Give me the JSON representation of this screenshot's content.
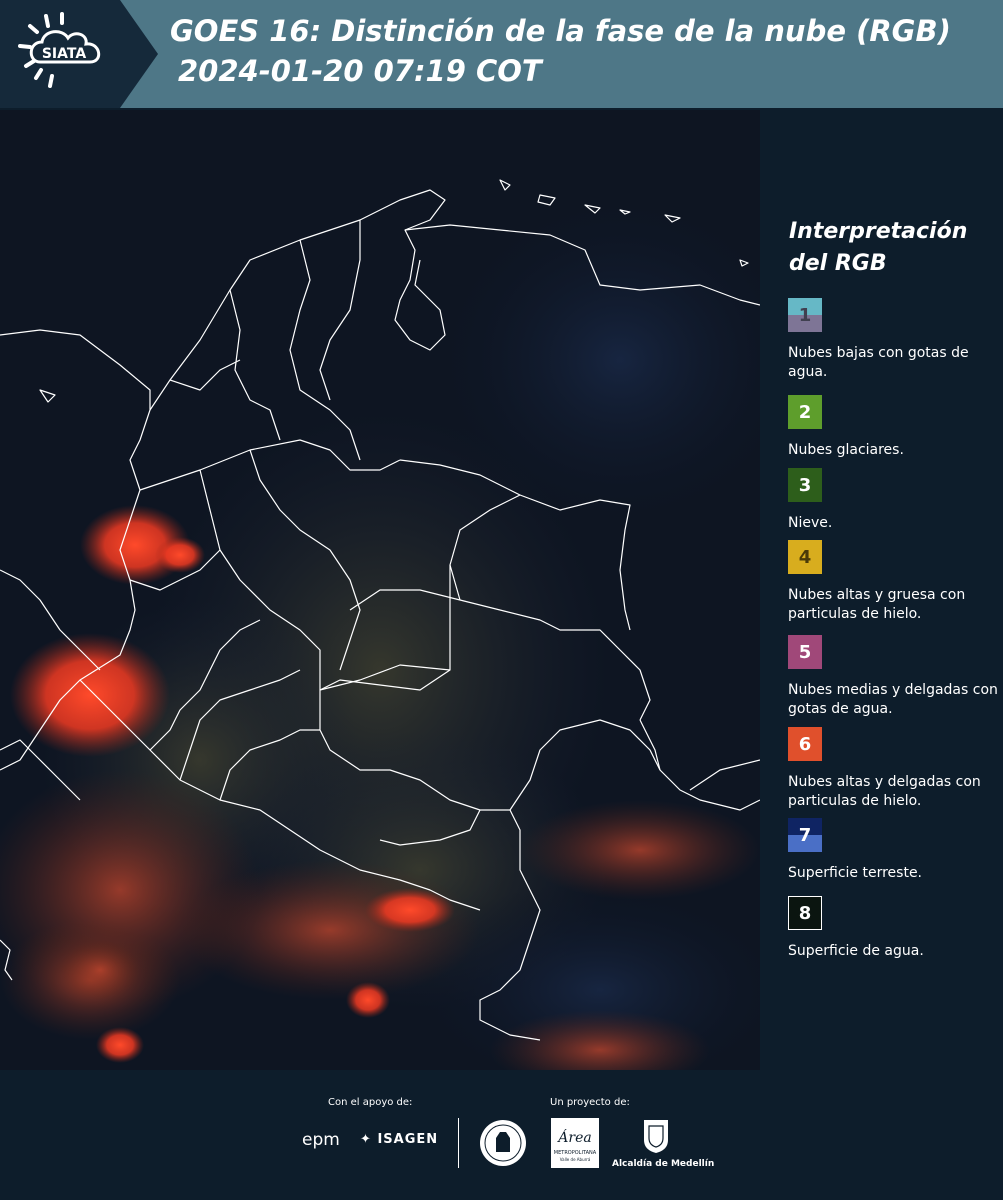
{
  "header": {
    "logo_text": "SIATA",
    "title_line1": "GOES 16: Distinción de la fase de la nube (RGB)",
    "title_line2": "2024-01-20 07:19 COT"
  },
  "legend": {
    "title": "Interpretación del RGB",
    "items": [
      {
        "number": "1",
        "label": "Nubes bajas con gotas de agua.",
        "colors": [
          "#66b8c6",
          "#7e7596"
        ]
      },
      {
        "number": "2",
        "label": "Nubes glaciares.",
        "colors": [
          "#5e9e2c"
        ]
      },
      {
        "number": "3",
        "label": "Nieve.",
        "colors": [
          "#2d5e1b"
        ]
      },
      {
        "number": "4",
        "label": "Nubes altas y gruesa con particulas de hielo.",
        "colors": [
          "#d8ad1e"
        ]
      },
      {
        "number": "5",
        "label": "Nubes medias y delgadas con gotas de agua.",
        "colors": [
          "#a04879"
        ]
      },
      {
        "number": "6",
        "label": "Nubes altas y delgadas con particulas de hielo.",
        "colors": [
          "#e0502c"
        ]
      },
      {
        "number": "7",
        "label": "Superficie terreste.",
        "colors": [
          "#0f2463",
          "#4a6fc6"
        ]
      },
      {
        "number": "8",
        "label": "Superficie de agua.",
        "colors": [
          "#0b1510"
        ]
      }
    ]
  },
  "footer": {
    "support_label": "Con el apoyo de:",
    "project_label": "Un proyecto de:",
    "epm": "epm",
    "isagen": "ISAGEN",
    "amva_logo_text": "Área METROPOLITANA Valle de Aburrá",
    "medellin": "Alcaldía de Medellín"
  }
}
